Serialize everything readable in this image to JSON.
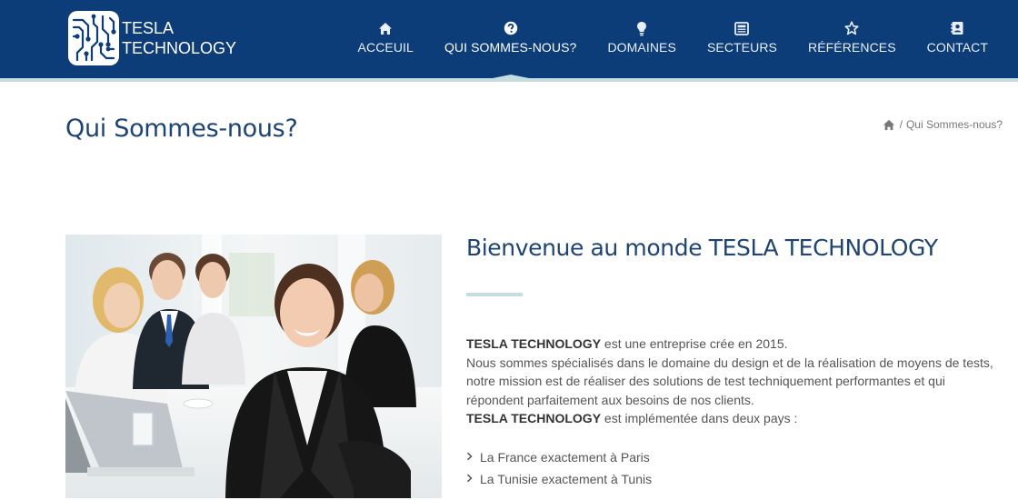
{
  "brand": {
    "line1": "TESLA",
    "line2": "TECHNOLOGY"
  },
  "nav": [
    {
      "label": "ACCEUIL",
      "icon": "home-icon"
    },
    {
      "label": "QUI SOMMES-NOUS?",
      "icon": "question-circle-icon",
      "active": true
    },
    {
      "label": "DOMAINES",
      "icon": "lightbulb-icon"
    },
    {
      "label": "SECTEURS",
      "icon": "newspaper-icon"
    },
    {
      "label": "RÉFÉRENCES",
      "icon": "star-icon"
    },
    {
      "label": "CONTACT",
      "icon": "address-book-icon"
    }
  ],
  "page": {
    "title": "Qui Sommes-nous?",
    "breadcrumb": {
      "home_icon": "home-icon",
      "separator": "/",
      "current": "Qui Sommes-nous?"
    }
  },
  "content": {
    "heading": "Bienvenue au monde TESLA TECHNOLOGY",
    "company": "TESLA TECHNOLOGY",
    "p1_rest": " est une entreprise crée en 2015.",
    "p2": "Nous sommes spécialisés dans le domaine du design et de la réalisation de moyens de tests, notre mission est de réaliser des solutions de test techniquement performantes et qui répondent parfaitement aux besoins de nos clients.",
    "p3_rest": " est implémentée dans deux pays :",
    "countries": [
      "La France exactement à Paris",
      "La Tunisie exactement à Tunis"
    ]
  },
  "colors": {
    "header": "#0d3d78",
    "accent": "#c5dce0",
    "title": "#1d4474"
  }
}
